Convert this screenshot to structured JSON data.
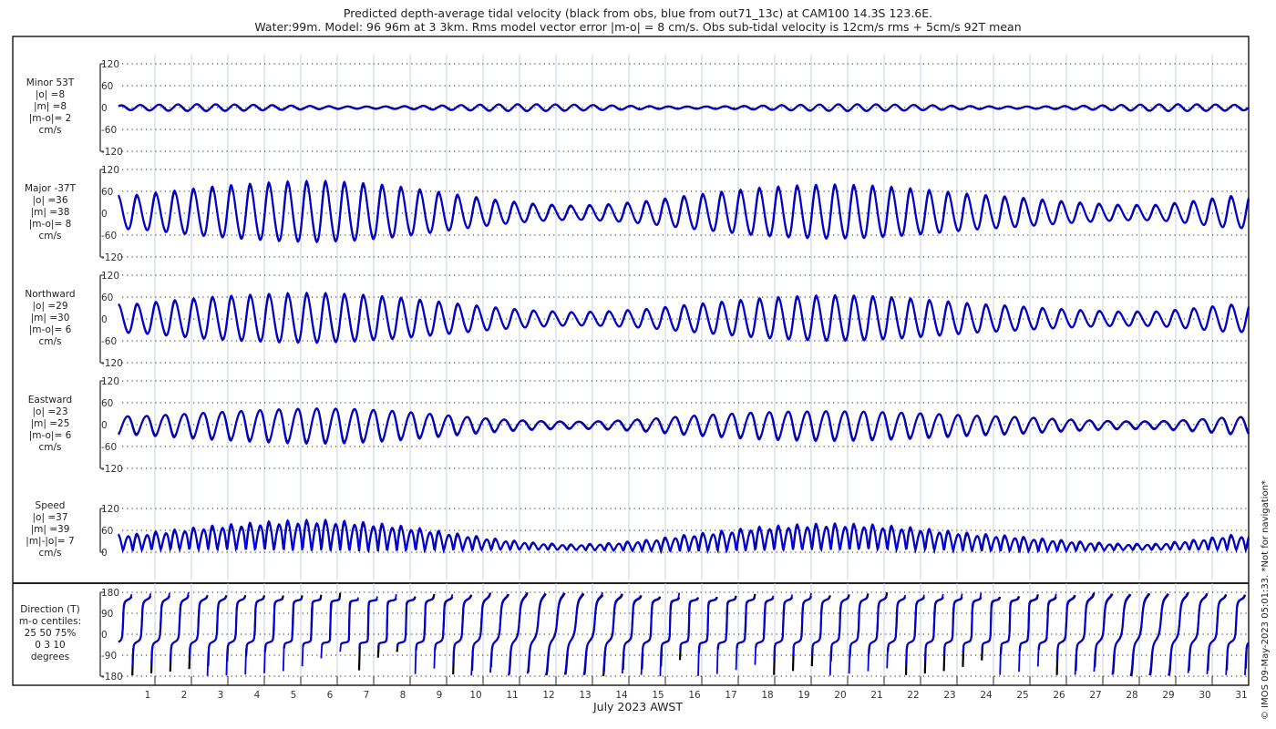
{
  "title": {
    "line1": "Predicted depth-average tidal velocity (black from obs, blue from out71_13c) at CAM100 14.3S 123.6E.",
    "line2": "Water:99m. Model: 96 96m at 3 3km. Rms model vector error |m-o| = 8 cm/s. Obs sub-tidal velocity is 12cm/s rms + 5cm/s 92T mean"
  },
  "credit": "© IMOS 09-May-2023 05:01:33. *Not for navigation*",
  "colors": {
    "obs": "#000000",
    "model": "#0000ee",
    "grid": "#b8c4e0"
  },
  "chart_data": {
    "type": "line",
    "xlabel": "July 2023 AWST",
    "xticks": [
      "1",
      "2",
      "3",
      "4",
      "5",
      "6",
      "7",
      "8",
      "9",
      "10",
      "11",
      "12",
      "13",
      "14",
      "15",
      "16",
      "17",
      "18",
      "19",
      "20",
      "21",
      "22",
      "23",
      "24",
      "25",
      "26",
      "27",
      "28",
      "29",
      "30",
      "31"
    ],
    "xlim_days": [
      0,
      31
    ],
    "series": [
      "obs",
      "model"
    ],
    "major_daily_amplitude_cm_s": [
      45,
      55,
      65,
      72,
      78,
      80,
      76,
      68,
      56,
      43,
      31,
      22,
      18,
      22,
      30,
      42,
      52,
      62,
      68,
      71,
      69,
      63,
      55,
      46,
      40,
      32,
      25,
      20,
      20,
      30,
      42
    ],
    "panels": [
      {
        "id": "minor",
        "labels": [
          "Minor 53T",
          "|o| =8",
          "|m| =8",
          "|m-o|= 2",
          "cm/s"
        ],
        "yticks": [
          "120",
          "60",
          "0",
          "-60",
          "-120"
        ],
        "ylim": [
          -120,
          120
        ]
      },
      {
        "id": "major",
        "labels": [
          "Major -37T",
          "|o| =36",
          "|m| =38",
          "|m-o|= 8",
          "cm/s"
        ],
        "yticks": [
          "120",
          "60",
          "0",
          "-60",
          "-120"
        ],
        "ylim": [
          -120,
          120
        ]
      },
      {
        "id": "north",
        "labels": [
          "Northward",
          "|o| =29",
          "|m| =30",
          "|m-o|= 6",
          "cm/s"
        ],
        "yticks": [
          "120",
          "60",
          "0",
          "-60",
          "-120"
        ],
        "ylim": [
          -120,
          120
        ]
      },
      {
        "id": "east",
        "labels": [
          "Eastward",
          "|o| =23",
          "|m| =25",
          "|m-o|= 6",
          "cm/s"
        ],
        "yticks": [
          "120",
          "60",
          "0",
          "-60",
          "-120"
        ],
        "ylim": [
          -120,
          120
        ]
      },
      {
        "id": "speed",
        "labels": [
          "Speed",
          "|o| =37",
          "|m| =39",
          "|m|-|o|= 7",
          "cm/s"
        ],
        "yticks": [
          "120",
          "60",
          "0"
        ],
        "ylim": [
          0,
          120
        ]
      },
      {
        "id": "direction",
        "labels": [
          "Direction (T)",
          "m-o centiles:",
          "25  50  75%",
          "0   3  10",
          "degrees"
        ],
        "yticks": [
          "180",
          "90",
          "0",
          "-90",
          "-180"
        ],
        "ylim": [
          -180,
          180
        ]
      }
    ]
  }
}
